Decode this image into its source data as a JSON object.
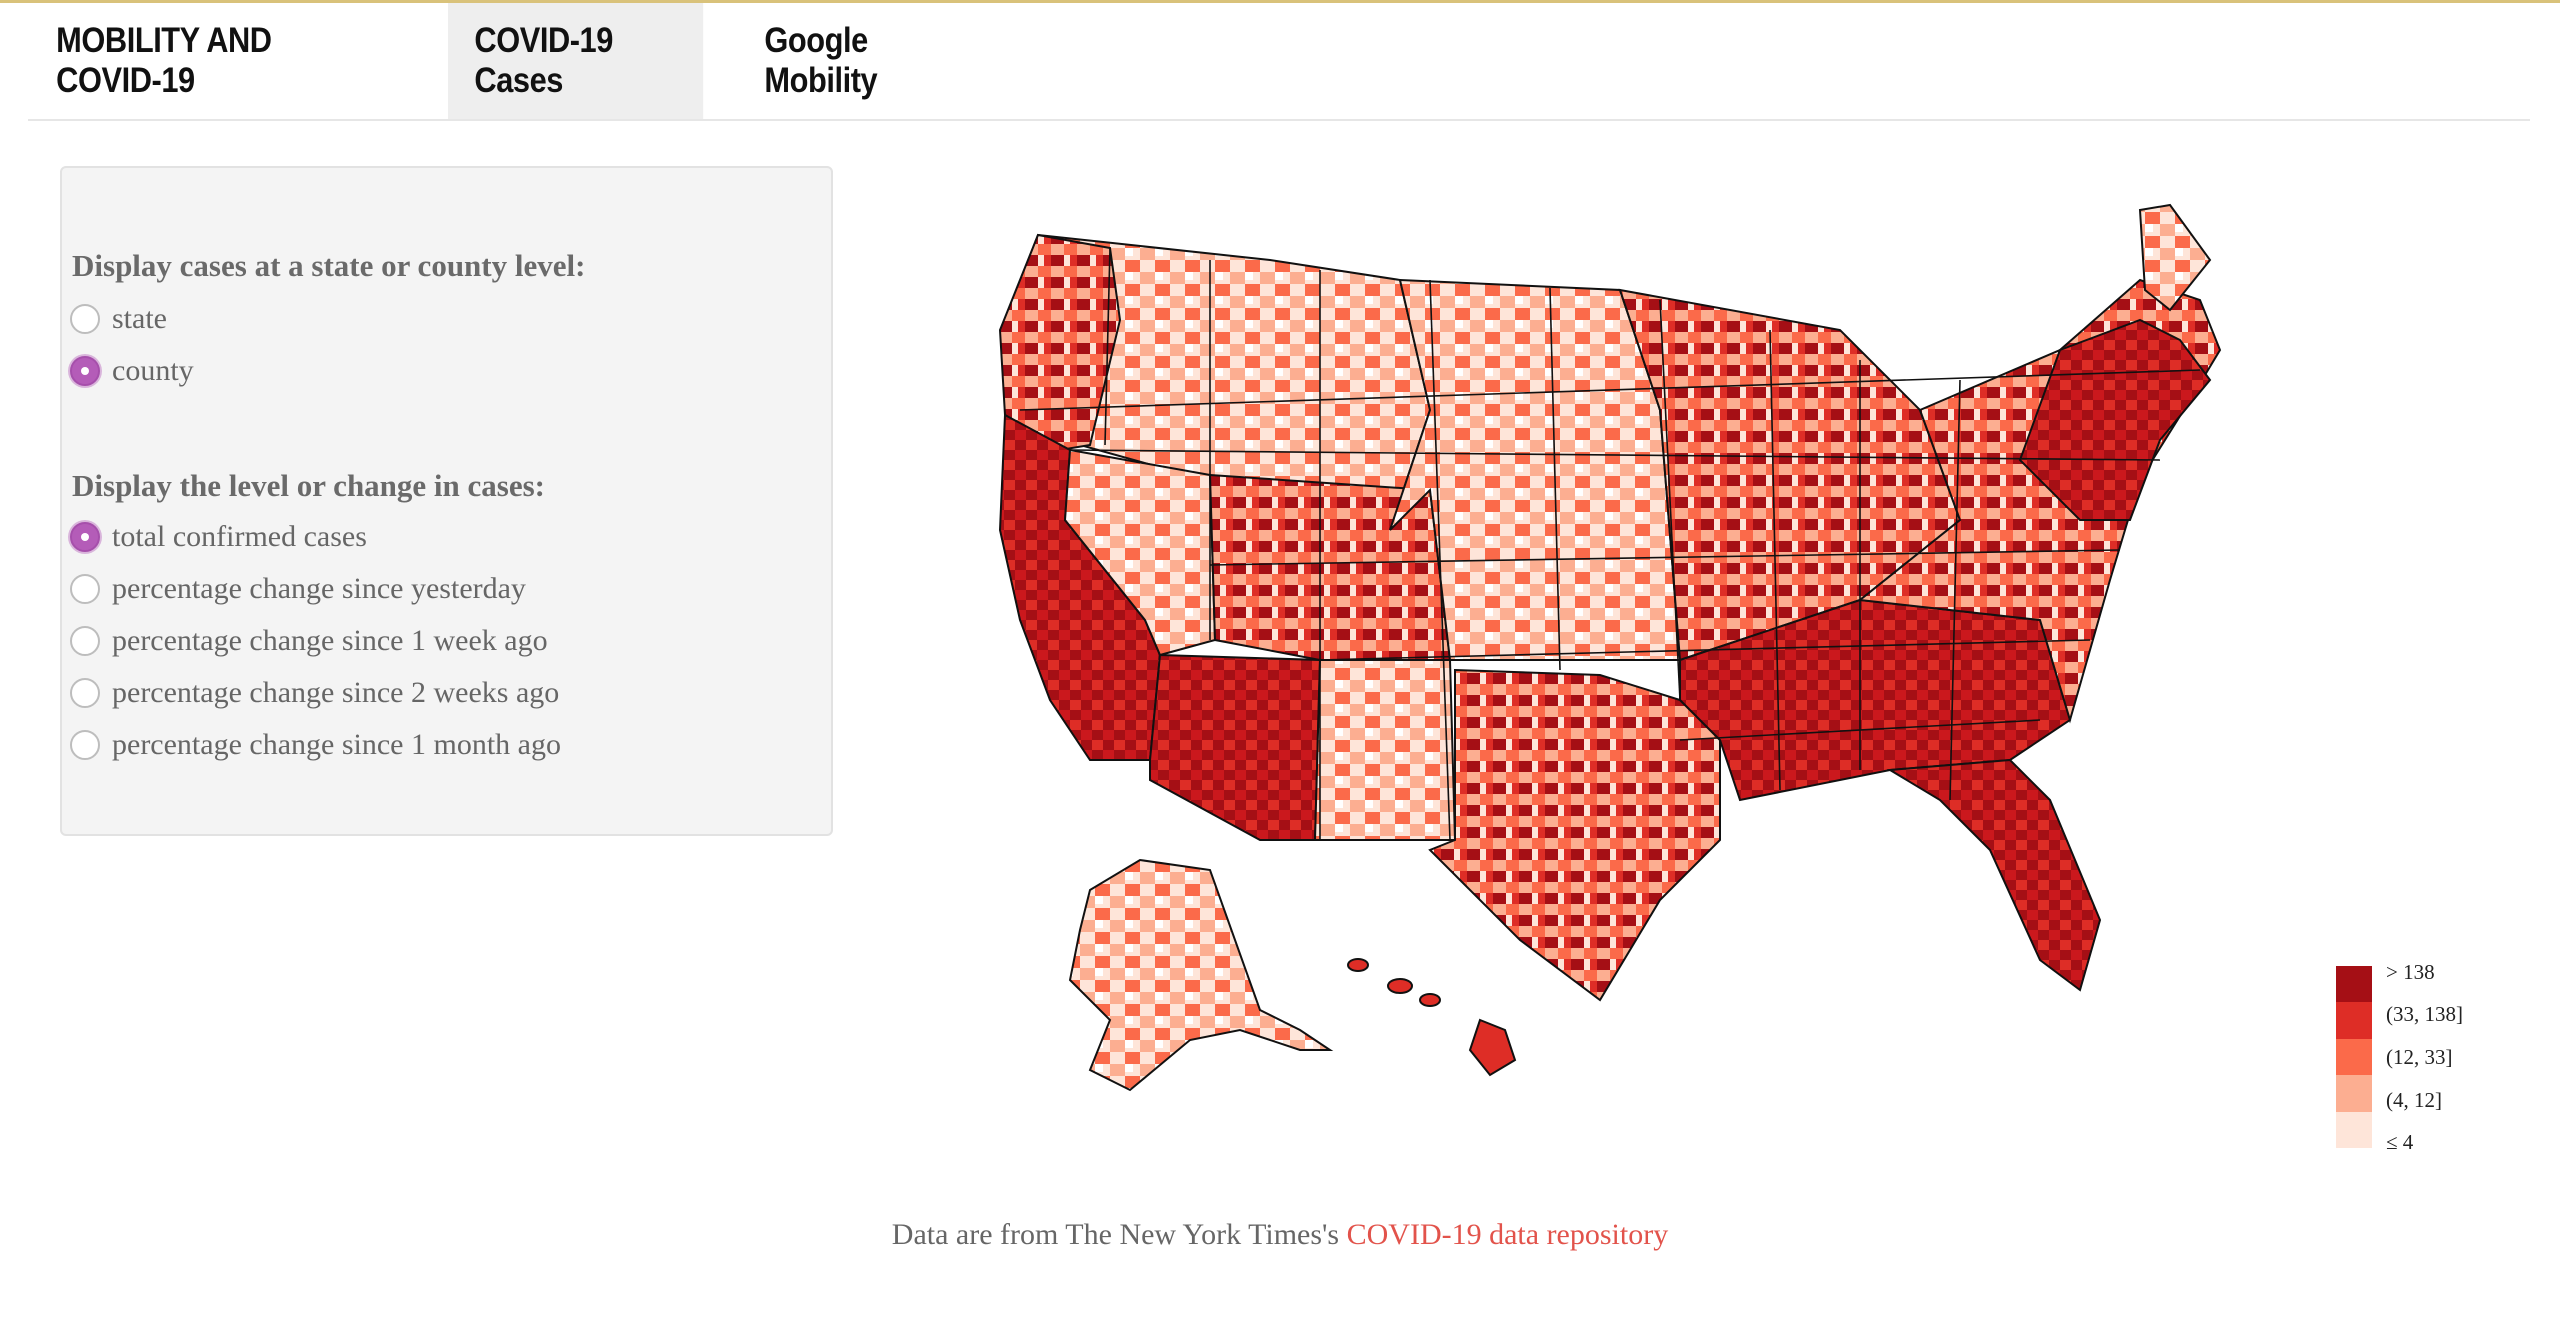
{
  "navbar": {
    "brand": "MOBILITY AND COVID-19",
    "tabs": [
      {
        "label": "COVID-19 Cases",
        "active": true
      },
      {
        "label": "Google Mobility",
        "active": false
      }
    ]
  },
  "sidebar": {
    "level_group": {
      "label": "Display cases at a state or county level:",
      "options": [
        {
          "label": "state",
          "checked": false
        },
        {
          "label": "county",
          "checked": true
        }
      ]
    },
    "metric_group": {
      "label": "Display the level or change in cases:",
      "options": [
        {
          "label": "total confirmed cases",
          "checked": true
        },
        {
          "label": "percentage change since yesterday",
          "checked": false
        },
        {
          "label": "percentage change since 1 week ago",
          "checked": false
        },
        {
          "label": "percentage change since 2 weeks ago",
          "checked": false
        },
        {
          "label": "percentage change since 1 month ago",
          "checked": false
        }
      ]
    }
  },
  "legend": {
    "items": [
      {
        "label": "> 138",
        "color": "#a50f15"
      },
      {
        "label": "(33, 138]",
        "color": "#de2d26"
      },
      {
        "label": "(12, 33]",
        "color": "#fb6a4a"
      },
      {
        "label": "(4, 12]",
        "color": "#fcae91"
      },
      {
        "label": "≤ 4",
        "color": "#fee5d9"
      }
    ]
  },
  "caption": {
    "prefix": "Data are from The New York Times's ",
    "link": "COVID-19 data repository"
  },
  "colors": {
    "radio_checked": "#b45cb8",
    "link": "#e2534b",
    "active_tab_bg": "#eeeeee"
  }
}
